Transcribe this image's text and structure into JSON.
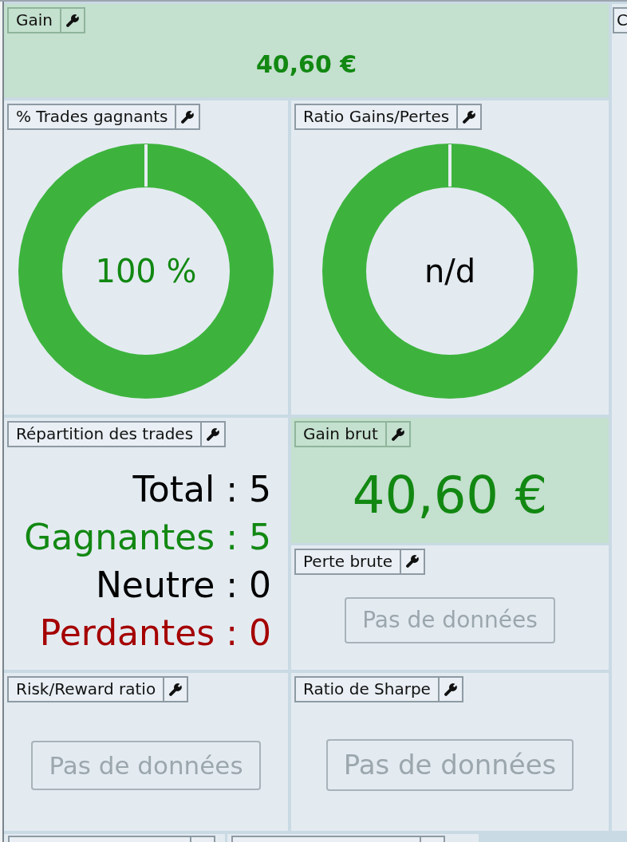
{
  "side_panel": {
    "title": "C"
  },
  "rows": [
    {
      "columns": [
        [
          {
            "kind": "summary",
            "title": "Gain",
            "highlighted": true,
            "value": "40,60 €",
            "color": "#128812"
          }
        ]
      ]
    },
    {
      "columns": [
        [
          {
            "kind": "donut",
            "title": "% Trades gagnants",
            "highlighted": false,
            "center": "100 %",
            "color": "#128812"
          }
        ],
        [
          {
            "kind": "donut",
            "title": "Ratio Gains/Pertes",
            "highlighted": false,
            "center": "n/d",
            "color": "#000000"
          }
        ]
      ]
    },
    {
      "columns": [
        [
          {
            "kind": "breakdown",
            "title": "Répartition des trades",
            "highlighted": false,
            "lines": [
              {
                "text": "Total : 5",
                "color": "#000000"
              },
              {
                "text": "Gagnantes : 5",
                "color": "#128812"
              },
              {
                "text": "Neutre : 0",
                "color": "#000000"
              },
              {
                "text": "Perdantes : 0",
                "color": "#a50000"
              }
            ]
          }
        ],
        [
          {
            "kind": "value",
            "title": "Gain brut",
            "highlighted": true,
            "value": "40,60 €",
            "color": "#128812"
          },
          {
            "kind": "empty",
            "title": "Perte brute",
            "highlighted": false,
            "message": "Pas de données"
          }
        ]
      ]
    },
    {
      "columns": [
        [
          {
            "kind": "empty",
            "title": "Risk/Reward ratio",
            "highlighted": false,
            "message": "Pas de données"
          }
        ],
        [
          {
            "kind": "empty",
            "title": "Ratio de Sharpe",
            "highlighted": false,
            "message": "Pas de données"
          }
        ]
      ]
    }
  ]
}
